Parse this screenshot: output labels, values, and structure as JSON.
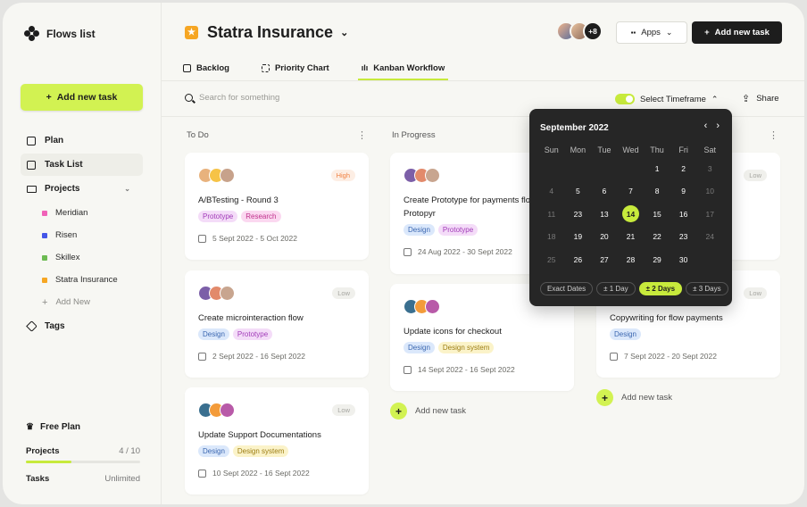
{
  "sidebar": {
    "brand": "Flows list",
    "add_button": "Add new task",
    "nav": {
      "plan": "Plan",
      "task_list": "Task List",
      "projects": "Projects",
      "tags": "Tags"
    },
    "projects": [
      {
        "name": "Meridian",
        "color": "#f062b8"
      },
      {
        "name": "Risen",
        "color": "#4456e8"
      },
      {
        "name": "Skillex",
        "color": "#6dbb52"
      },
      {
        "name": "Statra Insurance",
        "color": "#f6a623"
      }
    ],
    "add_new": "Add New",
    "plan_box": {
      "title": "Free Plan",
      "projects_label": "Projects",
      "projects_value": "4 / 10",
      "projects_fraction": 0.4,
      "tasks_label": "Tasks",
      "tasks_value": "Unlimited"
    }
  },
  "header": {
    "project_title": "Statra Insurance",
    "tabs": [
      "Backlog",
      "Priority Chart",
      "Kanban Workflow"
    ],
    "active_tab": "Kanban Workflow",
    "avatars_more": "+8",
    "apps_label": "Apps",
    "add_task_label": "Add new task"
  },
  "toolbar": {
    "search_placeholder": "Search for something",
    "timeframe_label": "Select Timeframe",
    "share_label": "Share"
  },
  "columns": [
    {
      "title": "To Do",
      "cards": [
        {
          "title": "A/BTesting - Round 3",
          "priority": "High",
          "tags": [
            "Prototype",
            "Research"
          ],
          "date": "5 Sept 2022 - 5 Oct 2022"
        },
        {
          "title": "Create microinteraction flow",
          "priority": "Low",
          "tags": [
            "Design",
            "Prototype"
          ],
          "date": "2 Sept 2022 - 16 Sept 2022"
        },
        {
          "title": "Update Support Documentations",
          "priority": "Low",
          "tags": [
            "Design",
            "Design system"
          ],
          "date": "10 Sept 2022 - 16 Sept 2022"
        }
      ]
    },
    {
      "title": "In Progress",
      "cards": [
        {
          "title": "Create Prototype for payments flow in Protopyr",
          "priority": "",
          "tags": [
            "Design",
            "Prototype"
          ],
          "date": "24 Aug 2022 - 30 Sept 2022"
        },
        {
          "title": "Update icons for checkout",
          "priority": "",
          "tags": [
            "Design",
            "Design system"
          ],
          "date": "14 Sept 2022 - 16 Sept 2022"
        }
      ],
      "add_new": "Add new task"
    },
    {
      "title": "",
      "cards": [
        {
          "title": "",
          "priority": "Low",
          "tags": [],
          "date": ""
        },
        {
          "title": "Copywriting for flow payments",
          "priority": "Low",
          "tags": [
            "Design"
          ],
          "date": "7 Sept 2022 - 20 Sept 2022"
        }
      ],
      "add_new": "Add new task"
    }
  ],
  "datepicker": {
    "month": "September 2022",
    "weekdays": [
      "Sun",
      "Mon",
      "Tue",
      "Wed",
      "Thu",
      "Fri",
      "Sat"
    ],
    "weeks": [
      [
        "",
        "",
        "",
        "",
        "1",
        "2",
        "3"
      ],
      [
        "4",
        "5",
        "6",
        "7",
        "8",
        "9",
        "10"
      ],
      [
        "11",
        "23",
        "13",
        "14",
        "15",
        "16",
        "17"
      ],
      [
        "18",
        "19",
        "20",
        "21",
        "22",
        "23",
        "24"
      ],
      [
        "25",
        "26",
        "27",
        "28",
        "29",
        "30",
        ""
      ]
    ],
    "selected": "14",
    "dim_days": [
      "3",
      "4",
      "10",
      "11",
      "17",
      "18",
      "24",
      "25"
    ],
    "chips": [
      "Exact Dates",
      "± 1 Day",
      "± 2 Days",
      "± 3 Days"
    ],
    "active_chip": "± 2 Days"
  },
  "colors": {
    "accent": "#d2f252",
    "dark": "#1d1d1d",
    "high": "#f08040"
  }
}
